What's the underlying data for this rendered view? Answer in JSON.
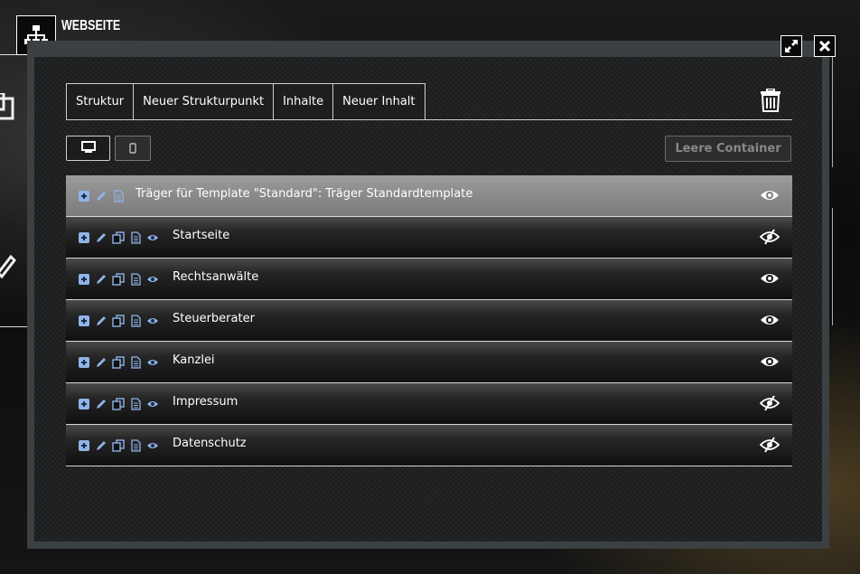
{
  "header": {
    "app_title": "WEBSEITE",
    "app_icon": "sitemap-icon",
    "expand_icon": "expand-icon",
    "close_icon": "close-icon"
  },
  "tabs": [
    {
      "label": "Struktur"
    },
    {
      "label": "Neuer Strukturpunkt"
    },
    {
      "label": "Inhalte"
    },
    {
      "label": "Neuer Inhalt"
    }
  ],
  "toolbar": {
    "trash_icon": "trash-icon",
    "desktop_icon": "desktop-icon",
    "mobile_icon": "mobile-icon",
    "empty_container_label": "Leere Container"
  },
  "tree": {
    "template_row": {
      "label": "Träger für Template \"Standard\": Träger Standardtemplate",
      "visible": true
    },
    "items": [
      {
        "label": "Startseite",
        "visible": false
      },
      {
        "label": "Rechtsanwälte",
        "visible": true
      },
      {
        "label": "Steuerberater",
        "visible": true
      },
      {
        "label": "Kanzlei",
        "visible": true
      },
      {
        "label": "Impressum",
        "visible": false
      },
      {
        "label": "Datenschutz",
        "visible": false
      }
    ]
  },
  "colors": {
    "accent_icon": "#8fb4e8",
    "modal_frame": "#3b4043",
    "modal_bg": "#1b1c1d"
  }
}
